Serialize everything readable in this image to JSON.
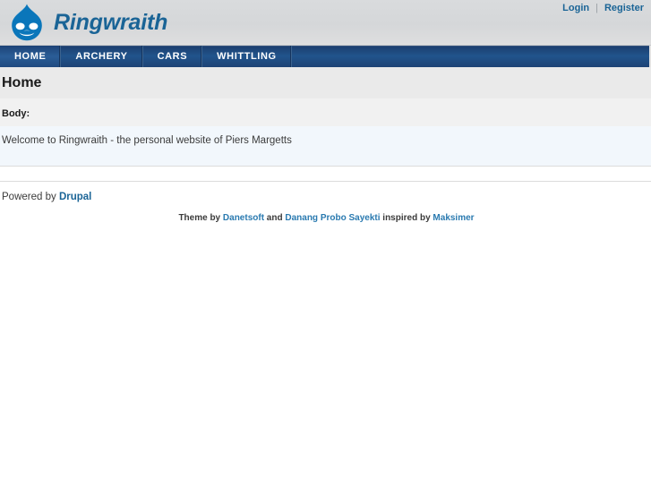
{
  "header": {
    "site_name": "Ringwraith",
    "logo_icon": "drupal-droplet-icon",
    "user_links": {
      "login": "Login",
      "separator": "|",
      "register": "Register"
    }
  },
  "nav": {
    "items": [
      {
        "label": "HOME",
        "active": true
      },
      {
        "label": "ARCHERY",
        "active": false
      },
      {
        "label": "CARS",
        "active": false
      },
      {
        "label": "WHITTLING",
        "active": false
      }
    ]
  },
  "main": {
    "page_title": "Home",
    "field_label": "Body:",
    "body_text": "Welcome to Ringwraith - the personal website of Piers Margetts"
  },
  "footer": {
    "powered_prefix": "Powered by ",
    "powered_link": "Drupal",
    "credit_theme_by": "Theme by ",
    "credit_author1": "Danetsoft",
    "credit_and": " and ",
    "credit_author2": "Danang Probo Sayekti",
    "credit_inspired": " inspired by ",
    "credit_author3": "Maksimer"
  },
  "colors": {
    "brand_blue": "#1a6496",
    "nav_navy": "#21548c",
    "link_blue": "#2a7ab0",
    "header_gray": "#d5d7d9",
    "body_band": "#f2f7fc"
  }
}
